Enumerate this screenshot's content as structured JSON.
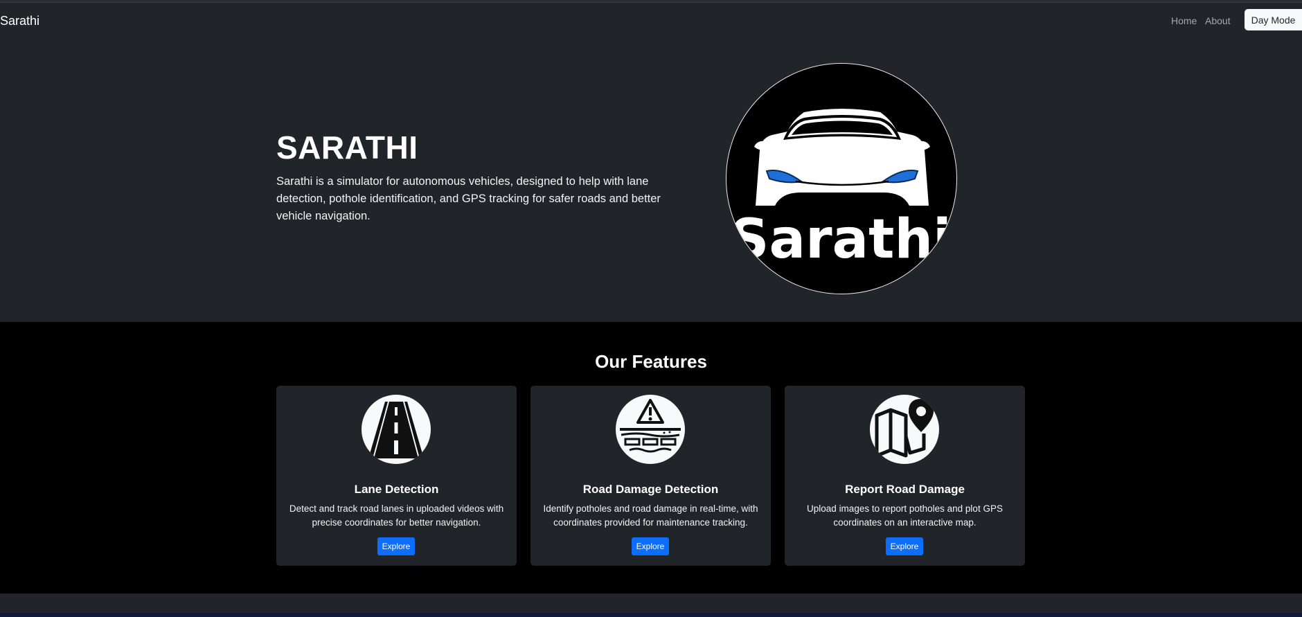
{
  "nav": {
    "brand": "Sarathi",
    "links": [
      "Home",
      "About"
    ],
    "theme_button": "Day Mode"
  },
  "hero": {
    "title": "SARATHI",
    "description": "Sarathi is a simulator for autonomous vehicles, designed to help with lane detection, pothole identification, and GPS tracking for safer roads and better vehicle navigation.",
    "logo_text": "Sarathi",
    "logo_icon": "car-logo-icon"
  },
  "features": {
    "heading": "Our Features",
    "cards": [
      {
        "title": "Lane Detection",
        "text": "Detect and track road lanes in uploaded videos with precise coordinates for better navigation.",
        "button": "Explore",
        "icon": "road-lanes-icon"
      },
      {
        "title": "Road Damage Detection",
        "text": "Identify potholes and road damage in real-time, with coordinates provided for maintenance tracking.",
        "button": "Explore",
        "icon": "road-warning-icon"
      },
      {
        "title": "Report Road Damage",
        "text": "Upload images to report potholes and plot GPS coordinates on an interactive map.",
        "button": "Explore",
        "icon": "map-pin-icon"
      }
    ]
  },
  "colors": {
    "background": "#212529",
    "features_background": "#000000",
    "accent": "#0d6efd"
  }
}
